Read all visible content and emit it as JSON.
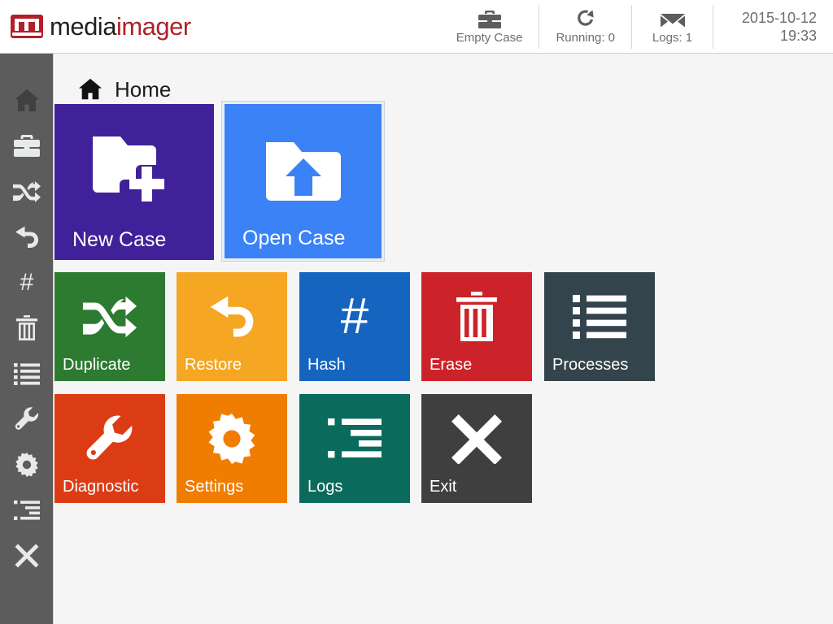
{
  "header": {
    "logo": {
      "mark_icon": "mediaimager-logo-mark",
      "text_dark": "media",
      "text_red": "imager",
      "brand_color": "#b12028"
    },
    "status": [
      {
        "icon": "briefcase-icon",
        "label": "Empty Case"
      },
      {
        "icon": "refresh-icon",
        "label": "Running: 0"
      },
      {
        "icon": "envelope-icon",
        "label": "Logs: 1"
      }
    ],
    "datetime": {
      "date": "2015-10-12",
      "time": "19:33"
    }
  },
  "sidebar": {
    "items": [
      {
        "icon": "home-icon",
        "name": "home",
        "active": true
      },
      {
        "icon": "briefcase-icon",
        "name": "case",
        "active": false
      },
      {
        "icon": "shuffle-icon",
        "name": "duplicate",
        "active": false
      },
      {
        "icon": "undo-icon",
        "name": "restore",
        "active": false
      },
      {
        "icon": "hash-icon",
        "name": "hash",
        "active": false
      },
      {
        "icon": "trash-icon",
        "name": "erase",
        "active": false
      },
      {
        "icon": "list-icon",
        "name": "processes",
        "active": false
      },
      {
        "icon": "wrench-icon",
        "name": "diagnostic",
        "active": false
      },
      {
        "icon": "gear-icon",
        "name": "settings",
        "active": false
      },
      {
        "icon": "indent-list-icon",
        "name": "logs",
        "active": false
      },
      {
        "icon": "close-icon",
        "name": "exit",
        "active": false
      }
    ]
  },
  "page": {
    "title": "Home",
    "title_icon": "home-icon"
  },
  "tiles": [
    {
      "id": "new-case",
      "label": "New Case",
      "icon": "folder-plus-icon",
      "color": "#40219a",
      "size": "big",
      "selected": false
    },
    {
      "id": "open-case",
      "label": "Open Case",
      "icon": "folder-upload-icon",
      "color": "#3b82f6",
      "size": "big",
      "selected": true
    },
    {
      "id": "duplicate",
      "label": "Duplicate",
      "icon": "shuffle-icon",
      "color": "#2d7a31",
      "size": "small",
      "selected": false
    },
    {
      "id": "restore",
      "label": "Restore",
      "icon": "undo-icon",
      "color": "#f5a623",
      "size": "small",
      "selected": false
    },
    {
      "id": "hash",
      "label": "Hash",
      "icon": "hash-icon",
      "color": "#1565c0",
      "size": "small",
      "selected": false
    },
    {
      "id": "erase",
      "label": "Erase",
      "icon": "trash-icon",
      "color": "#cc2229",
      "size": "small",
      "selected": false
    },
    {
      "id": "processes",
      "label": "Processes",
      "icon": "list-icon",
      "color": "#33444c",
      "size": "small",
      "selected": false
    },
    {
      "id": "diagnostic",
      "label": "Diagnostic",
      "icon": "wrench-icon",
      "color": "#dc3c14",
      "size": "small",
      "selected": false
    },
    {
      "id": "settings",
      "label": "Settings",
      "icon": "gear-icon",
      "color": "#f07c00",
      "size": "small",
      "selected": false
    },
    {
      "id": "logs",
      "label": "Logs",
      "icon": "indent-list-icon",
      "color": "#0a6b5c",
      "size": "small",
      "selected": false
    },
    {
      "id": "exit",
      "label": "Exit",
      "icon": "close-icon",
      "color": "#3f3f3f",
      "size": "small",
      "selected": false
    }
  ]
}
